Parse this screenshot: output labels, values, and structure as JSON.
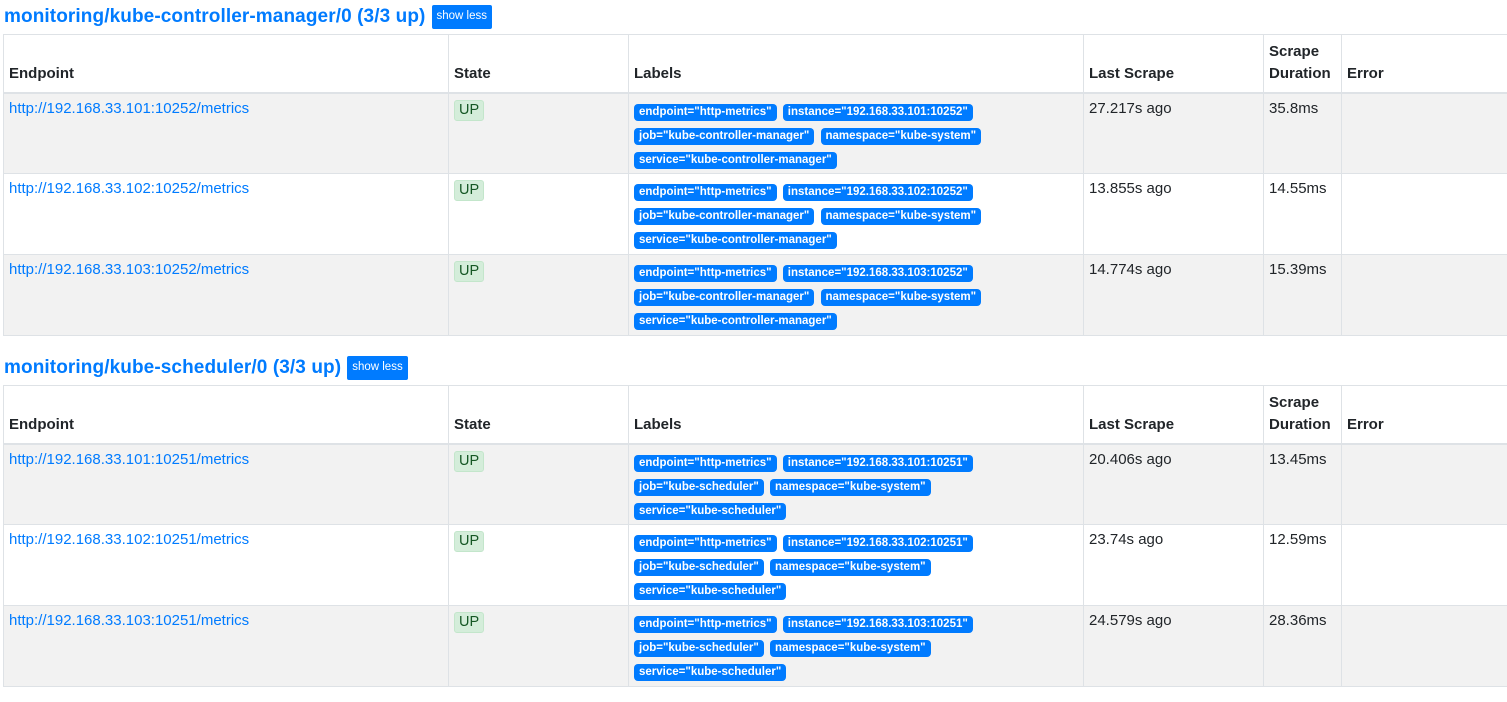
{
  "table_headers": {
    "endpoint": "Endpoint",
    "state": "State",
    "labels": "Labels",
    "last_scrape": "Last Scrape",
    "scrape_duration_1": "Scrape",
    "scrape_duration_2": "Duration",
    "error": "Error"
  },
  "sections": [
    {
      "title": "monitoring/kube-controller-manager/0 (3/3 up)",
      "toggle_label": "show less",
      "rows": [
        {
          "endpoint": "http://192.168.33.101:10252/metrics",
          "state": "UP",
          "labels": [
            "endpoint=\"http-metrics\"",
            "instance=\"192.168.33.101:10252\"",
            "job=\"kube-controller-manager\"",
            "namespace=\"kube-system\"",
            "service=\"kube-controller-manager\""
          ],
          "last_scrape": "27.217s ago",
          "duration": "35.8ms",
          "error": ""
        },
        {
          "endpoint": "http://192.168.33.102:10252/metrics",
          "state": "UP",
          "labels": [
            "endpoint=\"http-metrics\"",
            "instance=\"192.168.33.102:10252\"",
            "job=\"kube-controller-manager\"",
            "namespace=\"kube-system\"",
            "service=\"kube-controller-manager\""
          ],
          "last_scrape": "13.855s ago",
          "duration": "14.55ms",
          "error": ""
        },
        {
          "endpoint": "http://192.168.33.103:10252/metrics",
          "state": "UP",
          "labels": [
            "endpoint=\"http-metrics\"",
            "instance=\"192.168.33.103:10252\"",
            "job=\"kube-controller-manager\"",
            "namespace=\"kube-system\"",
            "service=\"kube-controller-manager\""
          ],
          "last_scrape": "14.774s ago",
          "duration": "15.39ms",
          "error": ""
        }
      ]
    },
    {
      "title": "monitoring/kube-scheduler/0 (3/3 up)",
      "toggle_label": "show less",
      "rows": [
        {
          "endpoint": "http://192.168.33.101:10251/metrics",
          "state": "UP",
          "labels": [
            "endpoint=\"http-metrics\"",
            "instance=\"192.168.33.101:10251\"",
            "job=\"kube-scheduler\"",
            "namespace=\"kube-system\"",
            "service=\"kube-scheduler\""
          ],
          "last_scrape": "20.406s ago",
          "duration": "13.45ms",
          "error": ""
        },
        {
          "endpoint": "http://192.168.33.102:10251/metrics",
          "state": "UP",
          "labels": [
            "endpoint=\"http-metrics\"",
            "instance=\"192.168.33.102:10251\"",
            "job=\"kube-scheduler\"",
            "namespace=\"kube-system\"",
            "service=\"kube-scheduler\""
          ],
          "last_scrape": "23.74s ago",
          "duration": "12.59ms",
          "error": ""
        },
        {
          "endpoint": "http://192.168.33.103:10251/metrics",
          "state": "UP",
          "labels": [
            "endpoint=\"http-metrics\"",
            "instance=\"192.168.33.103:10251\"",
            "job=\"kube-scheduler\"",
            "namespace=\"kube-system\"",
            "service=\"kube-scheduler\""
          ],
          "last_scrape": "24.579s ago",
          "duration": "28.36ms",
          "error": ""
        }
      ]
    }
  ],
  "colors": {
    "accent": "#007bff",
    "up_badge_bg": "#d4edda",
    "up_badge_text": "#155724",
    "row_striped": "#f2f2f2"
  }
}
